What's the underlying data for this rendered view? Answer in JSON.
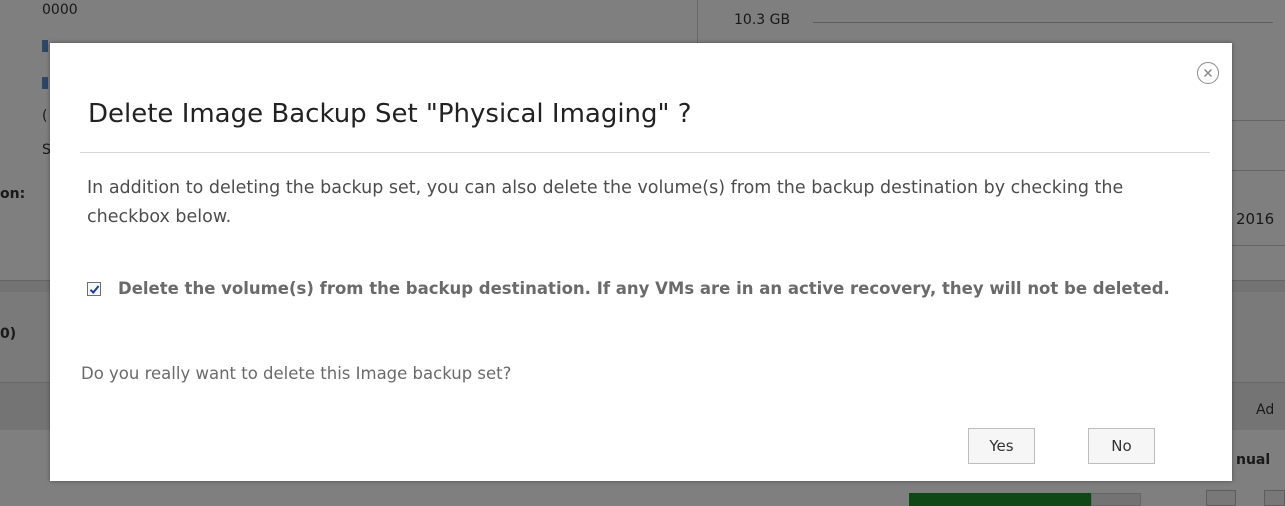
{
  "background": {
    "size_label": "10.3 GB",
    "top_partial_text": "0000",
    "label_on": "on:",
    "label_zero": "0)",
    "year_partial": "2016",
    "toolbar_partial": "Ad",
    "manual_partial": "nual"
  },
  "dialog": {
    "title": "Delete Image Backup Set \"Physical Imaging\" ?",
    "close_icon": "close-circle-icon",
    "message": "In addition to deleting the backup set, you can also delete the volume(s) from the backup destination by checking the checkbox below.",
    "checkbox": {
      "checked": true,
      "label": "Delete the volume(s) from the backup destination. If any VMs are in an active recovery, they will not be deleted."
    },
    "question": "Do you really want to delete this Image backup set?",
    "buttons": {
      "yes": "Yes",
      "no": "No"
    }
  },
  "colors": {
    "overlay": "#7f7f7f",
    "progress": "#1e8f2b"
  }
}
